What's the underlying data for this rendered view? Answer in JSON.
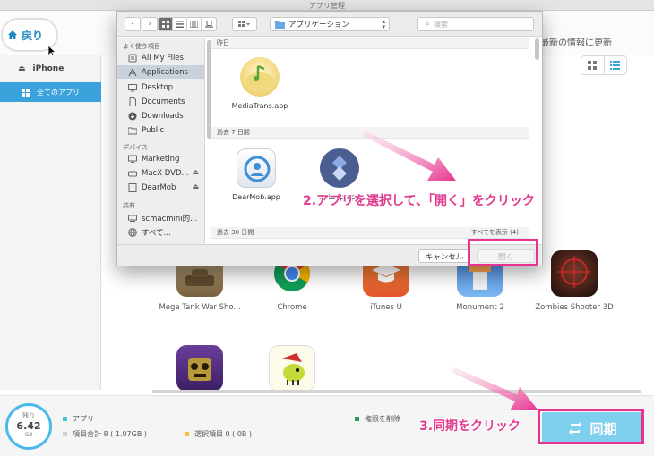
{
  "window": {
    "title": "アプリ管理"
  },
  "header": {
    "back_label": "戻り",
    "update_text": "最新の情報に更新"
  },
  "sidebar": {
    "device": "iPhone",
    "all_apps": "全てのアプリ"
  },
  "apps": [
    {
      "name": "Mega Tank War Sho...",
      "icon": "tank-icon"
    },
    {
      "name": "Chrome",
      "icon": "chrome-icon"
    },
    {
      "name": "iTunes U",
      "icon": "itunes-u-icon"
    },
    {
      "name": "Monument 2",
      "icon": "monument-icon"
    },
    {
      "name": "Zombies Shooter 3D",
      "icon": "zombie-icon"
    },
    {
      "name": "",
      "icon": "temple-run-icon"
    },
    {
      "name": "",
      "icon": "doodle-jump-icon"
    }
  ],
  "bottombar": {
    "storage_label": "残り",
    "storage_value": "6.42",
    "storage_unit": "GB",
    "legend_apps": "アプリ",
    "legend_total": "項目合計 8 ( 1.07GB )",
    "legend_selected": "選択項目 0 ( 0B )",
    "legend_delete": "権限を削除",
    "sync_label": "同期"
  },
  "dialog": {
    "location": "アプリケーション",
    "search_placeholder": "検索",
    "favorites_header": "よく使う項目",
    "favorites": [
      "All My Files",
      "Applications",
      "Desktop",
      "Documents",
      "Downloads",
      "Public"
    ],
    "devices_header": "デバイス",
    "devices": [
      "Marketing",
      "MacX DVD...",
      "DearMob"
    ],
    "shared_header": "共有",
    "shared": [
      "scmacmini的...",
      "すべて..."
    ],
    "groups": {
      "yesterday": "昨日",
      "past7": "過去 7 日間",
      "past30": "過去 30 日間",
      "show_all": "すべてを表示 (4)"
    },
    "files": {
      "mediatrans": "MediaTrans.app",
      "dearmob": "DearMob.app",
      "setapp": "Setapp.app"
    },
    "cancel_label": "キャンセル",
    "open_label": "開く"
  },
  "annotations": {
    "step2": "2.アプリを選択して、「開く」をクリック",
    "step3": "3.同期をクリック"
  },
  "colors": {
    "accent": "#3ba3dc",
    "highlight": "#e7358f",
    "sync": "#7fcfee"
  }
}
